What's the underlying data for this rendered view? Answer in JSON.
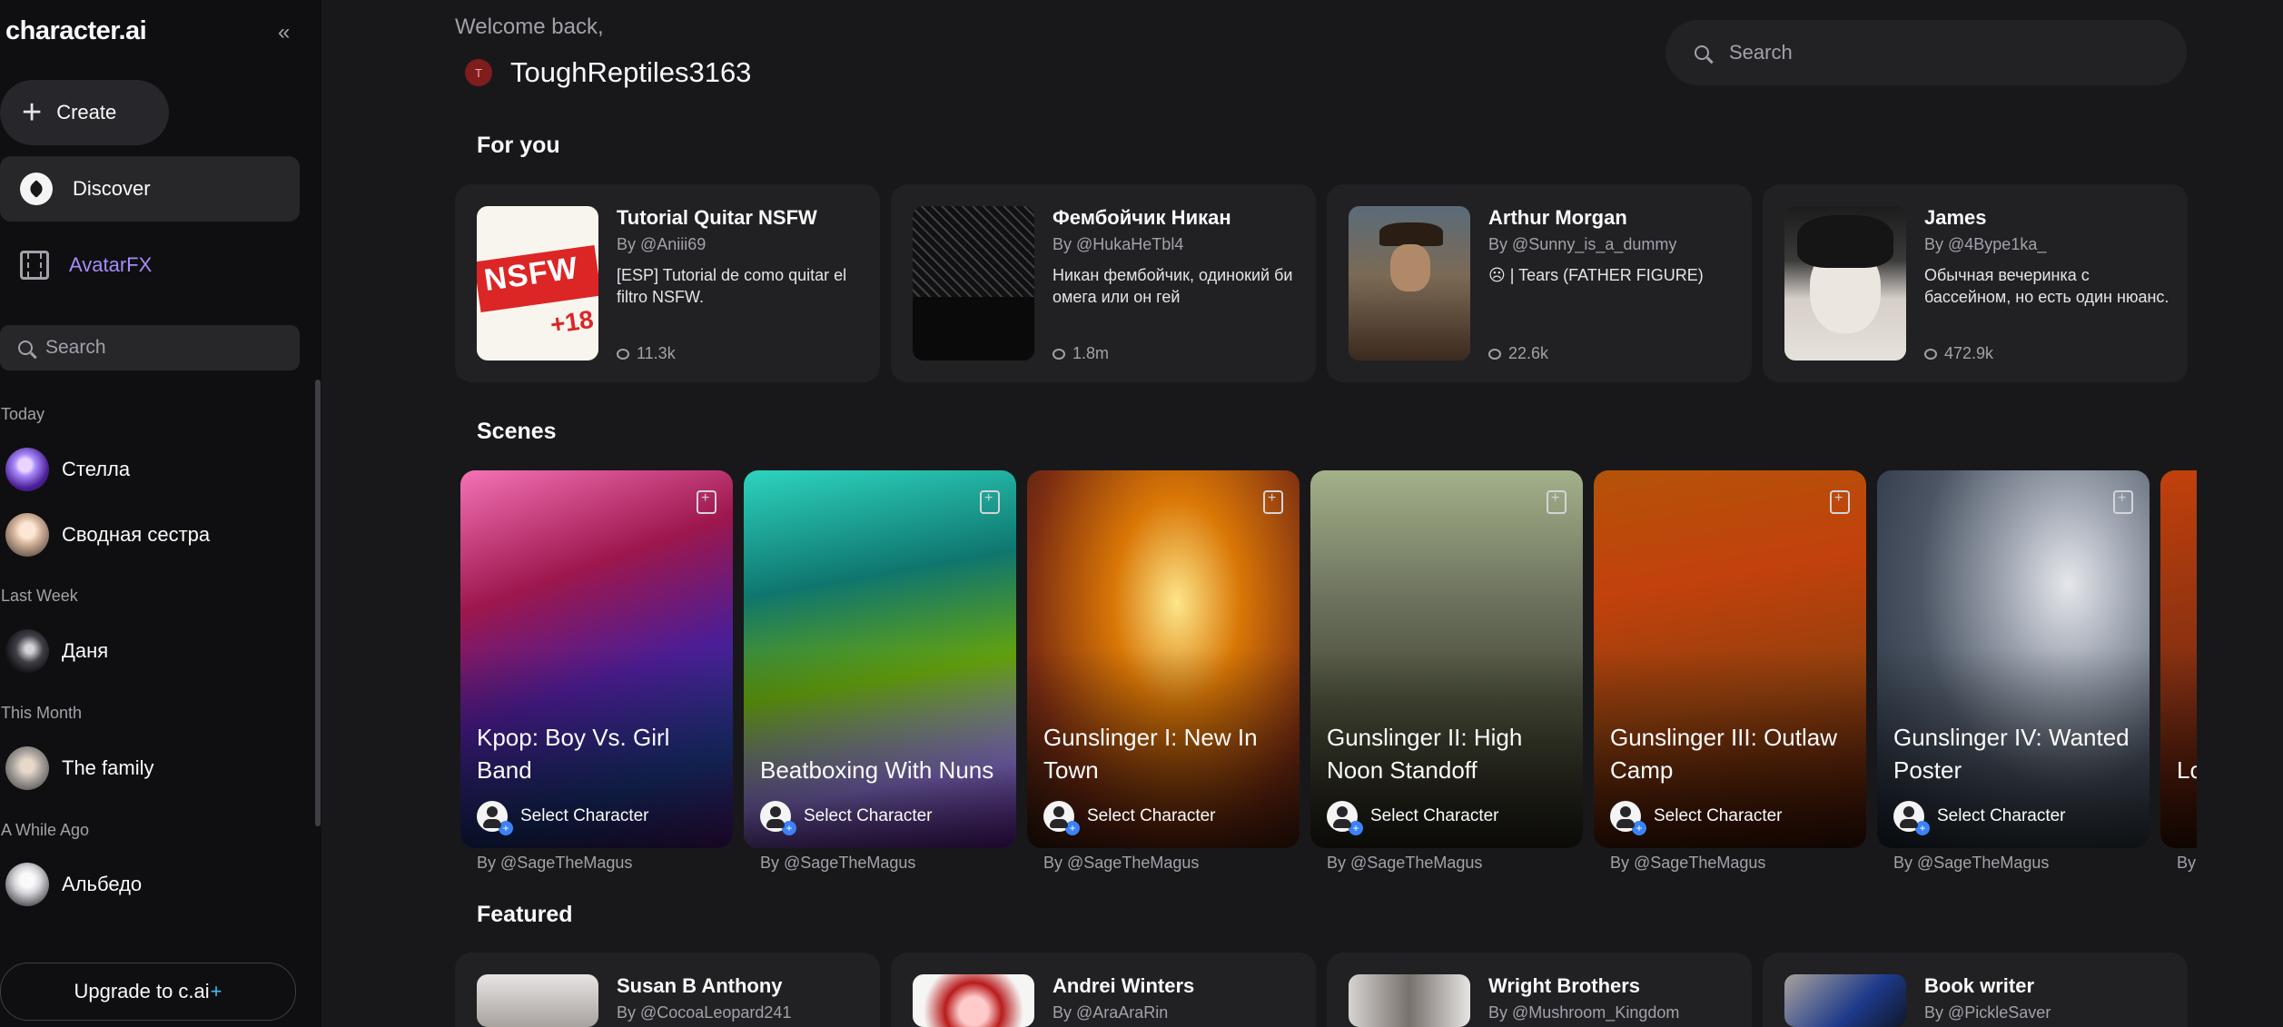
{
  "sidebar": {
    "logo": "character.ai",
    "create_label": "Create",
    "nav": [
      {
        "label": "Discover",
        "icon": "compass-icon"
      },
      {
        "label": "AvatarFX",
        "icon": "film-icon"
      }
    ],
    "search_placeholder": "Search",
    "groups": [
      {
        "label": "Today",
        "chats": [
          "Стелла",
          "Сводная сестра"
        ]
      },
      {
        "label": "Last Week",
        "chats": [
          "Даня"
        ]
      },
      {
        "label": "This Month",
        "chats": [
          "The family"
        ]
      },
      {
        "label": "A While Ago",
        "chats": [
          "Альбедо"
        ]
      }
    ],
    "upgrade_label": "Upgrade to c.ai",
    "upgrade_plus": "+"
  },
  "header": {
    "welcome": "Welcome back,",
    "avatar_initial": "T",
    "username": "ToughReptiles3163",
    "search_placeholder": "Search"
  },
  "sections": {
    "for_you": "For you",
    "scenes": "Scenes",
    "featured": "Featured"
  },
  "for_you": [
    {
      "title": "Tutorial Quitar NSFW",
      "author": "By @Aniii69",
      "desc": "[ESP] Tutorial de como quitar el filtro NSFW.",
      "count": "11.3k",
      "thumb_text": "NSFW",
      "thumb_sub": "+18"
    },
    {
      "title": "Фембойчик Никан",
      "author": "By @HukaHeTbl4",
      "desc": "Никан фембойчик, одинокий би омега или он гей",
      "count": "1.8m"
    },
    {
      "title": "Arthur Morgan",
      "author": "By @Sunny_is_a_dummy",
      "desc": "☹ | Tears (FATHER FIGURE)",
      "count": "22.6k"
    },
    {
      "title": "James",
      "author": "By @4Bype1ka_",
      "desc": "Обычная вечеринка с бассейном, но есть один нюанс.",
      "count": "472.9k"
    }
  ],
  "scenes": [
    {
      "title": "Kpop: Boy Vs. Girl Band",
      "select": "Select Character",
      "author": "By @SageTheMagus"
    },
    {
      "title": "Beatboxing With Nuns",
      "select": "Select Character",
      "author": "By @SageTheMagus"
    },
    {
      "title": "Gunslinger I: New In Town",
      "select": "Select Character",
      "author": "By @SageTheMagus"
    },
    {
      "title": "Gunslinger II: High Noon Standoff",
      "select": "Select Character",
      "author": "By @SageTheMagus"
    },
    {
      "title": "Gunslinger III: Outlaw Camp",
      "select": "Select Character",
      "author": "By @SageTheMagus"
    },
    {
      "title": "Gunslinger IV: Wanted Poster",
      "select": "Select Character",
      "author": "By @SageTheMagus"
    },
    {
      "title": "Lo Aw",
      "select": "",
      "author": "By"
    }
  ],
  "featured": [
    {
      "title": "Susan B Anthony",
      "author": "By @CocoaLeopard241"
    },
    {
      "title": "Andrei Winters",
      "author": "By @AraAraRin"
    },
    {
      "title": "Wright Brothers",
      "author": "By @Mushroom_Kingdom"
    },
    {
      "title": "Book writer",
      "author": "By @PickleSaver"
    }
  ]
}
